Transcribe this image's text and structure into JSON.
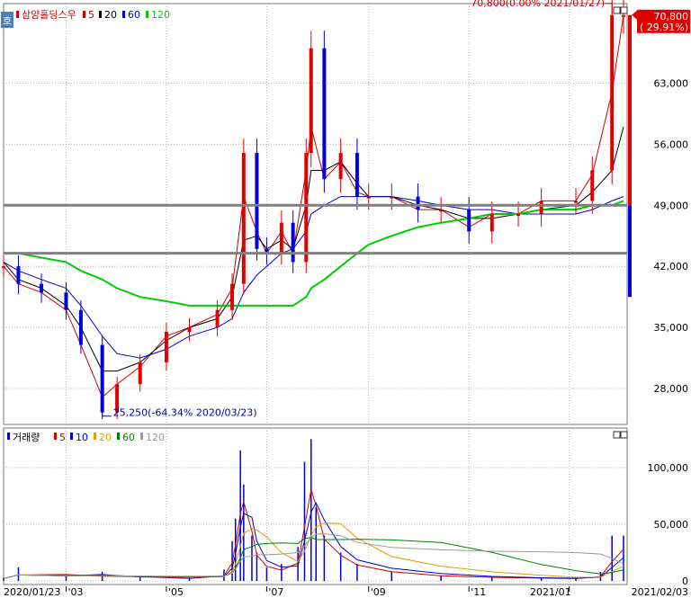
{
  "price_panel": {
    "stock_name": "삼양홀딩스우",
    "mode_badge": "호",
    "ma_legend": [
      {
        "label": "5",
        "color": "#d00000"
      },
      {
        "label": "20",
        "color": "#000000"
      },
      {
        "label": "60",
        "color": "#0000cc"
      },
      {
        "label": "120",
        "color": "#00cc00"
      }
    ],
    "last_annotation": "70,800(0.00% 2021/01/27)",
    "low_annotation": "25,250(-64.34% 2020/03/23)",
    "price_tag": "70,800",
    "change_tag": "( 29.91%)",
    "hlines": [
      49000,
      43500
    ]
  },
  "volume_panel": {
    "title": "거래량",
    "ma_legend": [
      {
        "label": "5",
        "color": "#d00000"
      },
      {
        "label": "10",
        "color": "#0000cc"
      },
      {
        "label": "20",
        "color": "#e0a000"
      },
      {
        "label": "60",
        "color": "#008000"
      },
      {
        "label": "120",
        "color": "#999999"
      }
    ]
  },
  "x_axis": {
    "ticks": [
      "2020/01/23",
      "'03",
      "'05",
      "'07",
      "'09",
      "'11",
      "2021/01"
    ],
    "last_date": "2021/02/03"
  },
  "colors": {
    "up": "#e00000",
    "down": "#0000dd",
    "ma5": "#d00000",
    "ma20": "#000000",
    "ma60": "#0000cc",
    "ma120": "#00cc00",
    "grid": "#b4b4b4",
    "hline": "#808080"
  },
  "chart_data": [
    {
      "type": "candlestick",
      "title": "삼양홀딩스우",
      "y_ticks": [
        28000,
        35000,
        42000,
        49000,
        56000,
        63000,
        70800
      ],
      "ylim": [
        24500,
        71500
      ],
      "series": [
        {
          "name": "price",
          "values": [
            [
              "2020-01-23",
              42000
            ],
            [
              "2020-02-01",
              40000
            ],
            [
              "2020-02-15",
              39000
            ],
            [
              "2020-03-01",
              37000
            ],
            [
              "2020-03-10",
              33000
            ],
            [
              "2020-03-23",
              25250
            ],
            [
              "2020-04-01",
              28500
            ],
            [
              "2020-04-15",
              31000
            ],
            [
              "2020-05-01",
              34500
            ],
            [
              "2020-05-15",
              35000
            ],
            [
              "2020-06-01",
              37000
            ],
            [
              "2020-06-10",
              40000
            ],
            [
              "2020-06-17",
              55000
            ],
            [
              "2020-06-25",
              44000
            ],
            [
              "2020-07-01",
              43500
            ],
            [
              "2020-07-10",
              47000
            ],
            [
              "2020-07-17",
              42500
            ],
            [
              "2020-07-25",
              55000
            ],
            [
              "2020-07-28",
              67000
            ],
            [
              "2020-08-05",
              52000
            ],
            [
              "2020-08-15",
              55000
            ],
            [
              "2020-08-25",
              50000
            ],
            [
              "2020-09-01",
              50000
            ],
            [
              "2020-09-15",
              50000
            ],
            [
              "2020-10-01",
              48500
            ],
            [
              "2020-10-15",
              48500
            ],
            [
              "2020-11-01",
              46000
            ],
            [
              "2020-11-15",
              48000
            ],
            [
              "2020-12-01",
              48000
            ],
            [
              "2020-12-15",
              49500
            ],
            [
              "2021-01-05",
              49500
            ],
            [
              "2021-01-15",
              53000
            ],
            [
              "2021-01-27",
              70800
            ],
            [
              "2021-02-03",
              70800
            ]
          ]
        },
        {
          "name": "5",
          "values": [
            42000,
            40000,
            39000,
            37000,
            33000,
            27000,
            28500,
            30500,
            34000,
            35000,
            36500,
            39500,
            50000,
            46000,
            43500,
            46000,
            43500,
            53000,
            58000,
            52000,
            54000,
            50500,
            50000,
            50000,
            48500,
            48500,
            46500,
            48000,
            48000,
            49500,
            49500,
            52500,
            62000,
            70800
          ]
        },
        {
          "name": "20",
          "values": [
            42500,
            40500,
            39500,
            37500,
            35000,
            30000,
            30000,
            31000,
            33500,
            35000,
            36000,
            38500,
            45000,
            45500,
            44000,
            45000,
            44000,
            49000,
            53000,
            53000,
            54000,
            51500,
            50000,
            50000,
            49000,
            48500,
            47500,
            47500,
            48000,
            48500,
            49000,
            50500,
            53000,
            58000
          ]
        },
        {
          "name": "60",
          "values": [
            42500,
            41500,
            40500,
            39500,
            37500,
            34000,
            32000,
            31500,
            32500,
            34000,
            35000,
            36000,
            39000,
            41000,
            42000,
            43500,
            44000,
            46000,
            48000,
            49000,
            50000,
            50000,
            50000,
            50000,
            49500,
            49000,
            48500,
            48500,
            48000,
            48000,
            48000,
            48500,
            49500,
            50000
          ]
        },
        {
          "name": "120",
          "values": [
            43500,
            43500,
            43000,
            42500,
            41500,
            40500,
            39500,
            38500,
            38000,
            37500,
            37500,
            37500,
            37500,
            37500,
            37500,
            37500,
            37500,
            38500,
            39500,
            40500,
            42000,
            43500,
            44500,
            45500,
            46500,
            47000,
            47500,
            48000,
            48000,
            48500,
            48500,
            49000,
            49000,
            49500
          ]
        }
      ]
    },
    {
      "type": "bar",
      "title": "거래량",
      "y_ticks": [
        0,
        50000,
        100000
      ],
      "ylim": [
        0,
        130000
      ],
      "series": [
        {
          "name": "volume",
          "values": [
            [
              "2020-01-23",
              3000
            ],
            [
              "2020-02-01",
              12000
            ],
            [
              "2020-03-01",
              4000
            ],
            [
              "2020-03-23",
              8000
            ],
            [
              "2020-04-15",
              3000
            ],
            [
              "2020-05-15",
              3000
            ],
            [
              "2020-06-05",
              10000
            ],
            [
              "2020-06-10",
              35000
            ],
            [
              "2020-06-12",
              55000
            ],
            [
              "2020-06-15",
              115000
            ],
            [
              "2020-06-17",
              85000
            ],
            [
              "2020-06-22",
              40000
            ],
            [
              "2020-06-25",
              25000
            ],
            [
              "2020-07-01",
              12000
            ],
            [
              "2020-07-10",
              15000
            ],
            [
              "2020-07-20",
              30000
            ],
            [
              "2020-07-24",
              105000
            ],
            [
              "2020-07-28",
              125000
            ],
            [
              "2020-07-31",
              65000
            ],
            [
              "2020-08-05",
              40000
            ],
            [
              "2020-08-15",
              25000
            ],
            [
              "2020-08-25",
              15000
            ],
            [
              "2020-09-15",
              8000
            ],
            [
              "2020-10-15",
              5000
            ],
            [
              "2020-11-15",
              4000
            ],
            [
              "2020-12-15",
              3000
            ],
            [
              "2021-01-05",
              3000
            ],
            [
              "2021-01-20",
              8000
            ],
            [
              "2021-01-27",
              40000
            ],
            [
              "2021-02-03",
              40000
            ]
          ]
        }
      ]
    }
  ]
}
